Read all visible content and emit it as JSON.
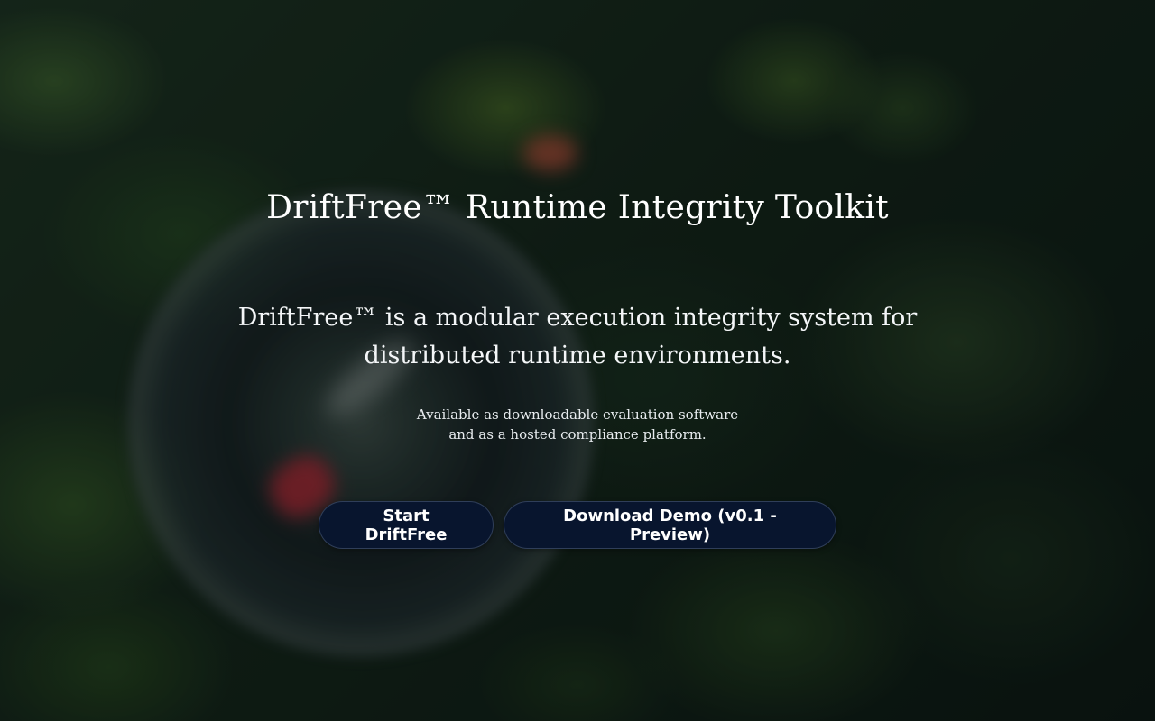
{
  "hero": {
    "title": "DriftFree™ Runtime Integrity Toolkit",
    "lead": "DriftFree™ is a modular execution integrity system for distributed runtime environments.",
    "note_line1": "Available as downloadable evaluation software",
    "note_line2": "and as a hosted compliance platform."
  },
  "actions": {
    "start_label": "Start DriftFree",
    "demo_label": "Download Demo (v0.1 - Preview)"
  },
  "colors": {
    "button_bg": "#08152e",
    "text": "#ffffff",
    "background_tint": "#142419"
  }
}
